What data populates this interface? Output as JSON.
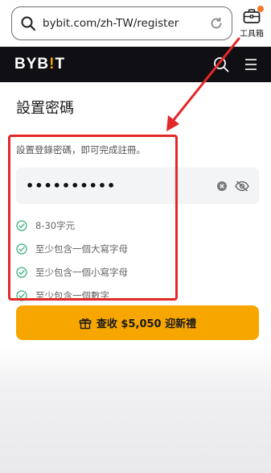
{
  "browser": {
    "url": "bybit.com/zh-TW/register",
    "toolbox_label": "工具箱"
  },
  "nav": {
    "logo_left": "BYB",
    "logo_bang": "!",
    "logo_right": "T"
  },
  "form": {
    "title": "設置密碼",
    "subtitle": "設置登錄密碼，即可完成註冊。",
    "password_value": "••••••••••",
    "rules": [
      {
        "text": "8-30字元"
      },
      {
        "text": "至少包含一個大寫字母"
      },
      {
        "text": "至少包含一個小寫字母"
      },
      {
        "text": "至少包含一個數字"
      }
    ]
  },
  "promo": {
    "label": "查收 $5,050 迎新禮"
  },
  "colors": {
    "brand": "#f7a600",
    "nav_bg": "#101014",
    "check": "#3fb27f",
    "annotation": "#e22828"
  }
}
